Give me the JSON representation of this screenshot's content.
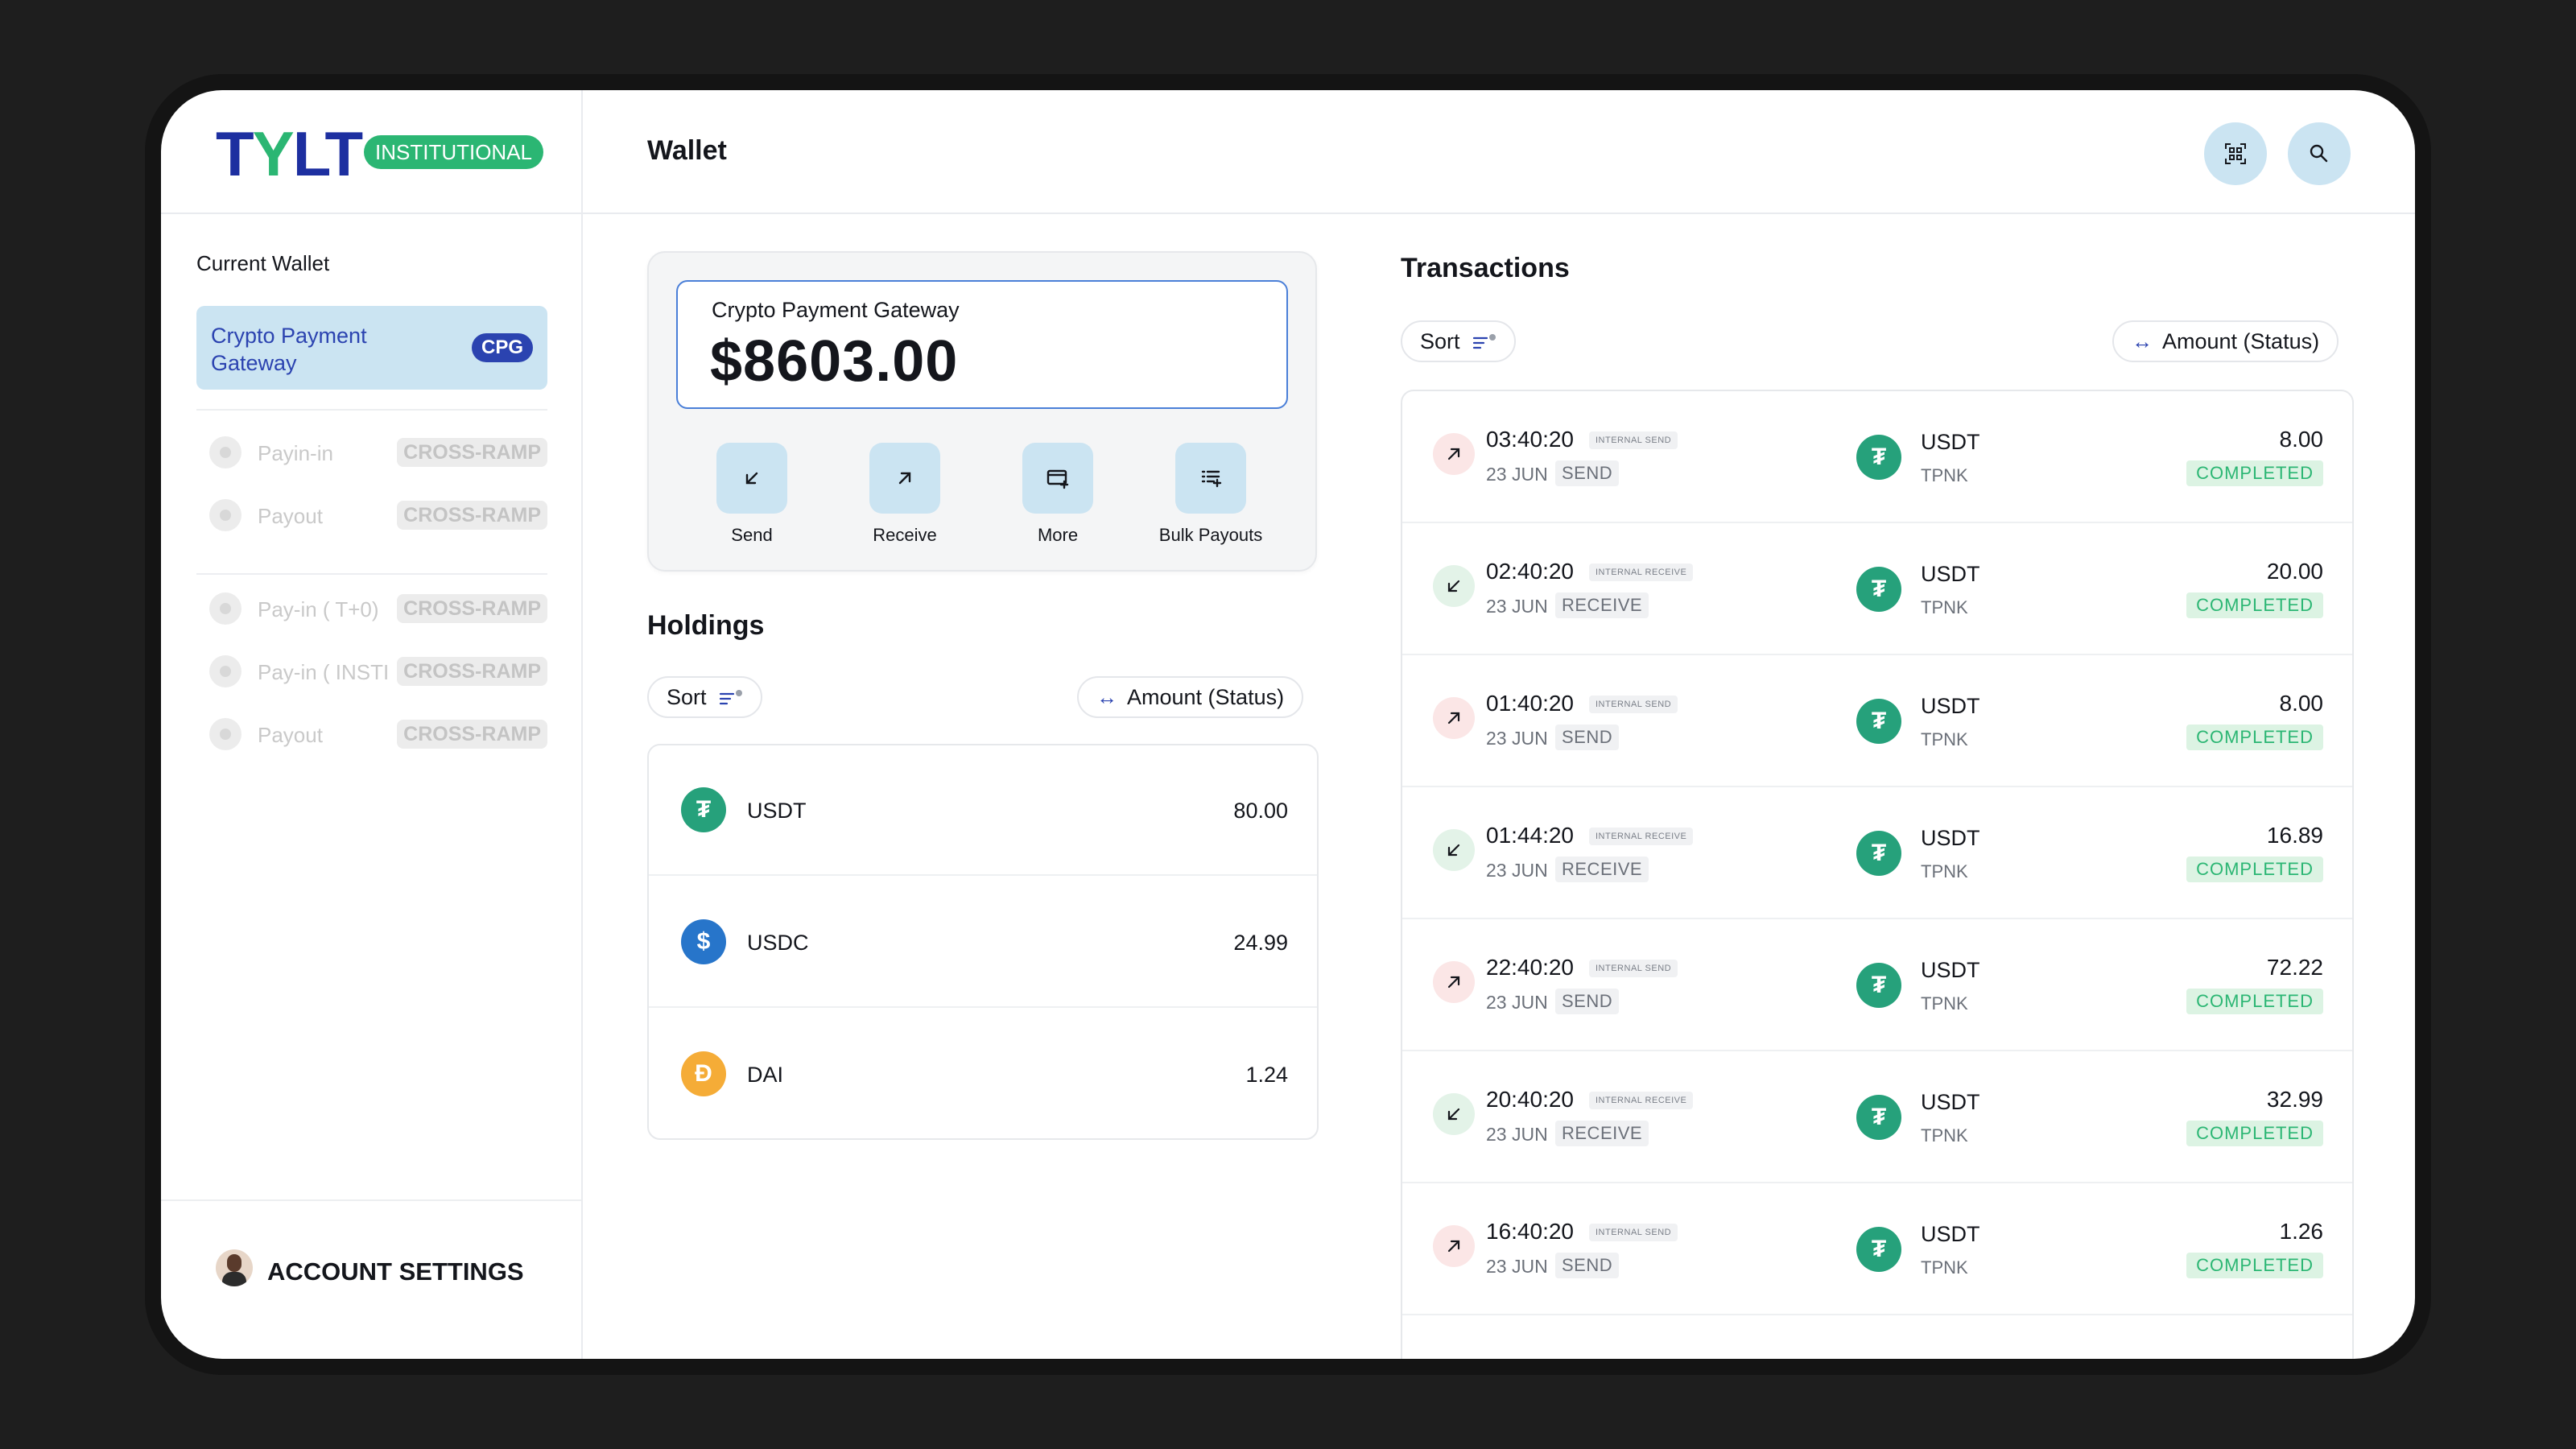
{
  "brand": {
    "logo_text_a": "T",
    "logo_text_y": "Y",
    "logo_text_b": "LT",
    "badge": "INSTITUTIONAL",
    "accent": "#2b43b0",
    "green": "#2bb673"
  },
  "sidebar": {
    "section_title": "Current Wallet",
    "current_wallet": {
      "label": "Crypto Payment Gateway",
      "badge": "CPG"
    },
    "items": [
      {
        "label": "Payin-in",
        "tag": "CROSS-RAMP"
      },
      {
        "label": "Payout",
        "tag": "CROSS-RAMP"
      },
      {
        "label": "Pay-in ( T+0)",
        "tag": "CROSS-RAMP"
      },
      {
        "label": "Pay-in ( INSTI",
        "tag": "CROSS-RAMP"
      },
      {
        "label": "Payout",
        "tag": "CROSS-RAMP"
      }
    ],
    "account_settings": "ACCOUNT SETTINGS"
  },
  "header": {
    "title": "Wallet",
    "qr_icon": "qr-scan-icon",
    "search_icon": "search-icon"
  },
  "wallet": {
    "label": "Crypto Payment Gateway",
    "balance": "$8603.00",
    "actions": [
      {
        "label": "Send",
        "icon": "arrow-down-left-icon"
      },
      {
        "label": "Receive",
        "icon": "arrow-up-right-icon"
      },
      {
        "label": "More",
        "icon": "card-plus-icon"
      },
      {
        "label": "Bulk Payouts",
        "icon": "list-plus-icon"
      }
    ]
  },
  "holdings": {
    "title": "Holdings",
    "sort_label": "Sort",
    "amount_label": "Amount (Status)",
    "rows": [
      {
        "symbol": "USDT",
        "value": "80.00",
        "color": "#26a17b"
      },
      {
        "symbol": "USDC",
        "value": "24.99",
        "color": "#2775ca"
      },
      {
        "symbol": "DAI",
        "value": "1.24",
        "color": "#f5ac37"
      }
    ]
  },
  "transactions": {
    "title": "Transactions",
    "sort_label": "Sort",
    "amount_label": "Amount (Status)",
    "rows": [
      {
        "time": "03:40:20",
        "type": "INTERNAL SEND",
        "date": "23 JUN",
        "kind": "SEND",
        "symbol": "USDT",
        "network": "TPNK",
        "amount": "8.00",
        "status": "COMPLETED"
      },
      {
        "time": "02:40:20",
        "type": "INTERNAL RECEIVE",
        "date": "23 JUN",
        "kind": "RECEIVE",
        "symbol": "USDT",
        "network": "TPNK",
        "amount": "20.00",
        "status": "COMPLETED"
      },
      {
        "time": "01:40:20",
        "type": "INTERNAL SEND",
        "date": "23 JUN",
        "kind": "SEND",
        "symbol": "USDT",
        "network": "TPNK",
        "amount": "8.00",
        "status": "COMPLETED"
      },
      {
        "time": "01:44:20",
        "type": "INTERNAL RECEIVE",
        "date": "23 JUN",
        "kind": "RECEIVE",
        "symbol": "USDT",
        "network": "TPNK",
        "amount": "16.89",
        "status": "COMPLETED"
      },
      {
        "time": "22:40:20",
        "type": "INTERNAL SEND",
        "date": "23 JUN",
        "kind": "SEND",
        "symbol": "USDT",
        "network": "TPNK",
        "amount": "72.22",
        "status": "COMPLETED"
      },
      {
        "time": "20:40:20",
        "type": "INTERNAL RECEIVE",
        "date": "23 JUN",
        "kind": "RECEIVE",
        "symbol": "USDT",
        "network": "TPNK",
        "amount": "32.99",
        "status": "COMPLETED"
      },
      {
        "time": "16:40:20",
        "type": "INTERNAL SEND",
        "date": "23 JUN",
        "kind": "SEND",
        "symbol": "USDT",
        "network": "TPNK",
        "amount": "1.26",
        "status": "COMPLETED"
      }
    ]
  }
}
